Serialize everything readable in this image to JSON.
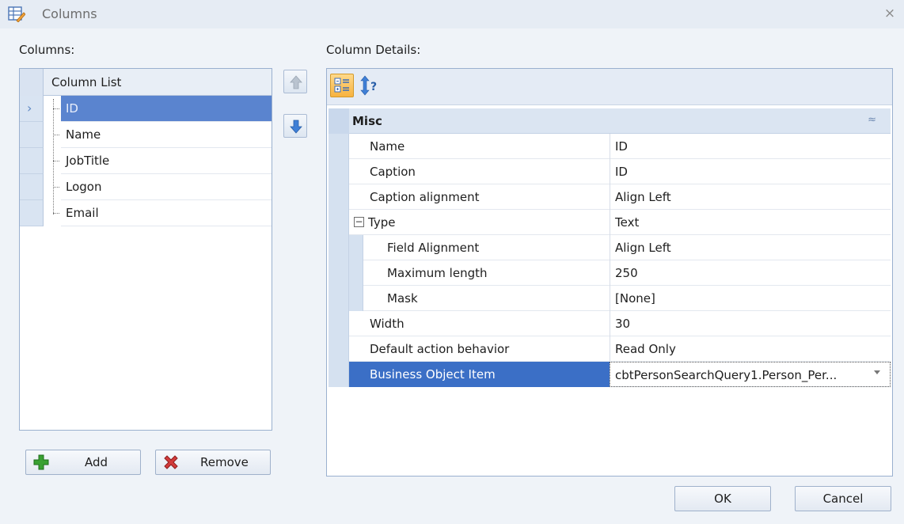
{
  "window": {
    "title": "Columns",
    "close_glyph": "×",
    "icon": "table-edit-icon"
  },
  "left": {
    "label": "Columns:",
    "column_list_header": "Column List",
    "rows": [
      {
        "label": "ID",
        "selected": true
      },
      {
        "label": "Name",
        "selected": false
      },
      {
        "label": "JobTitle",
        "selected": false
      },
      {
        "label": "Logon",
        "selected": false
      },
      {
        "label": "Email",
        "selected": false
      }
    ],
    "selected_marker": "›",
    "add_label": "Add",
    "remove_label": "Remove"
  },
  "side_buttons": {
    "up_icon": "arrow-up-icon",
    "down_icon": "arrow-down-icon"
  },
  "right": {
    "label": "Column Details:",
    "toolbar": {
      "categorized_icon": "categorized-icon",
      "sort_icon": "sort-alphabetical-icon"
    },
    "category": "Misc",
    "collapse_glyph": "≈",
    "properties": [
      {
        "name": "Name",
        "value": "ID"
      },
      {
        "name": "Caption",
        "value": "ID"
      },
      {
        "name": "Caption alignment",
        "value": "Align Left"
      },
      {
        "name": "Type",
        "value": "Text"
      },
      {
        "name": "Field Alignment",
        "value": "Align Left"
      },
      {
        "name": "Maximum length",
        "value": "250"
      },
      {
        "name": "Mask",
        "value": "[None]"
      },
      {
        "name": "Width",
        "value": "30"
      },
      {
        "name": "Default action behavior",
        "value": "Read Only"
      },
      {
        "name": "Business Object Item",
        "value": "cbtPersonSearchQuery1.Person_Per..."
      }
    ],
    "type_expander": "−"
  },
  "footer": {
    "ok_label": "OK",
    "cancel_label": "Cancel"
  },
  "colors": {
    "accent": "#3b6fc6",
    "selection_left": "#5a84cf",
    "add_green": "#3aa132",
    "remove_red": "#d23b3b"
  }
}
